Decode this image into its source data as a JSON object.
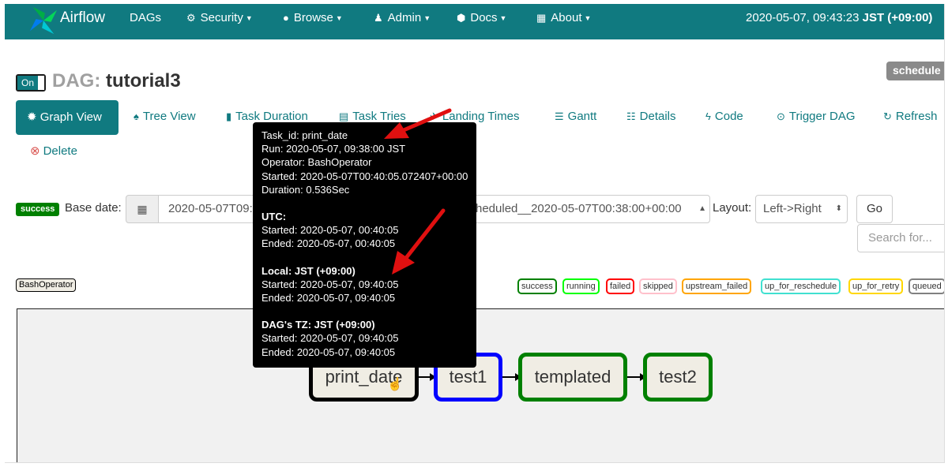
{
  "navbar": {
    "brand": "Airflow",
    "items": [
      {
        "label": "DAGs",
        "icon": "none",
        "dropdown": false
      },
      {
        "label": "Security",
        "icon": "cogs-icon",
        "dropdown": true
      },
      {
        "label": "Browse",
        "icon": "globe-icon",
        "dropdown": true
      },
      {
        "label": "Admin",
        "icon": "user-icon",
        "dropdown": true
      },
      {
        "label": "Docs",
        "icon": "cube-icon",
        "dropdown": true
      },
      {
        "label": "About",
        "icon": "grid-icon",
        "dropdown": true
      }
    ],
    "clock_time": "2020-05-07, 09:43:23",
    "clock_tz": "JST (+09:00)"
  },
  "dag": {
    "toggle_label": "On",
    "prefix": "DAG:",
    "name": "tutorial3",
    "schedule_badge": "schedule"
  },
  "views": {
    "graph": "Graph View",
    "tree": "Tree View",
    "task_duration": "Task Duration",
    "task_tries": "Task Tries",
    "landing_times": "Landing Times",
    "gantt": "Gantt",
    "details": "Details",
    "code": "Code",
    "trigger": "Trigger DAG",
    "refresh": "Refresh",
    "delete": "Delete"
  },
  "form": {
    "state_badge": "success",
    "base_date_label": "Base date:",
    "base_date_value": "2020-05-07T09:",
    "run_value": "scheduled__2020-05-07T00:38:00+00:00",
    "layout_label": "Layout:",
    "layout_value": "Left->Right",
    "go_label": "Go",
    "search_placeholder": "Search for..."
  },
  "legend": {
    "operator": "BashOperator",
    "states": [
      {
        "label": "success",
        "color": "#008000"
      },
      {
        "label": "running",
        "color": "#00ff00"
      },
      {
        "label": "failed",
        "color": "#ff0000"
      },
      {
        "label": "skipped",
        "color": "#ffc0cb"
      },
      {
        "label": "upstream_failed",
        "color": "#ffa500"
      },
      {
        "label": "up_for_reschedule",
        "color": "#40e0d0"
      },
      {
        "label": "up_for_retry",
        "color": "#ffd700"
      },
      {
        "label": "queued",
        "color": "#808080"
      }
    ]
  },
  "graph": {
    "nodes": [
      {
        "label": "print_date",
        "border": "#000000"
      },
      {
        "label": "test1",
        "border": "#0000ff"
      },
      {
        "label": "templated",
        "border": "#008000"
      },
      {
        "label": "test2",
        "border": "#008000"
      }
    ]
  },
  "tooltip": {
    "task_id": "Task_id: print_date",
    "run": "Run: 2020-05-07, 09:38:00 JST",
    "operator": "Operator: BashOperator",
    "started": "Started: 2020-05-07T00:40:05.072407+00:00",
    "duration": "Duration: 0.536Sec",
    "utc_head": "UTC:",
    "utc_started": "Started: 2020-05-07, 00:40:05",
    "utc_ended": "Ended: 2020-05-07, 00:40:05",
    "local_head": "Local: JST (+09:00)",
    "local_started": "Started: 2020-05-07, 09:40:05",
    "local_ended": "Ended: 2020-05-07, 09:40:05",
    "dagtz_head": "DAG's TZ: JST (+09:00)",
    "dagtz_started": "Started: 2020-05-07, 09:40:05",
    "dagtz_ended": "Ended: 2020-05-07, 09:40:05"
  },
  "colors": {
    "brand": "#107a80",
    "annotation_arrow": "#e01010"
  }
}
